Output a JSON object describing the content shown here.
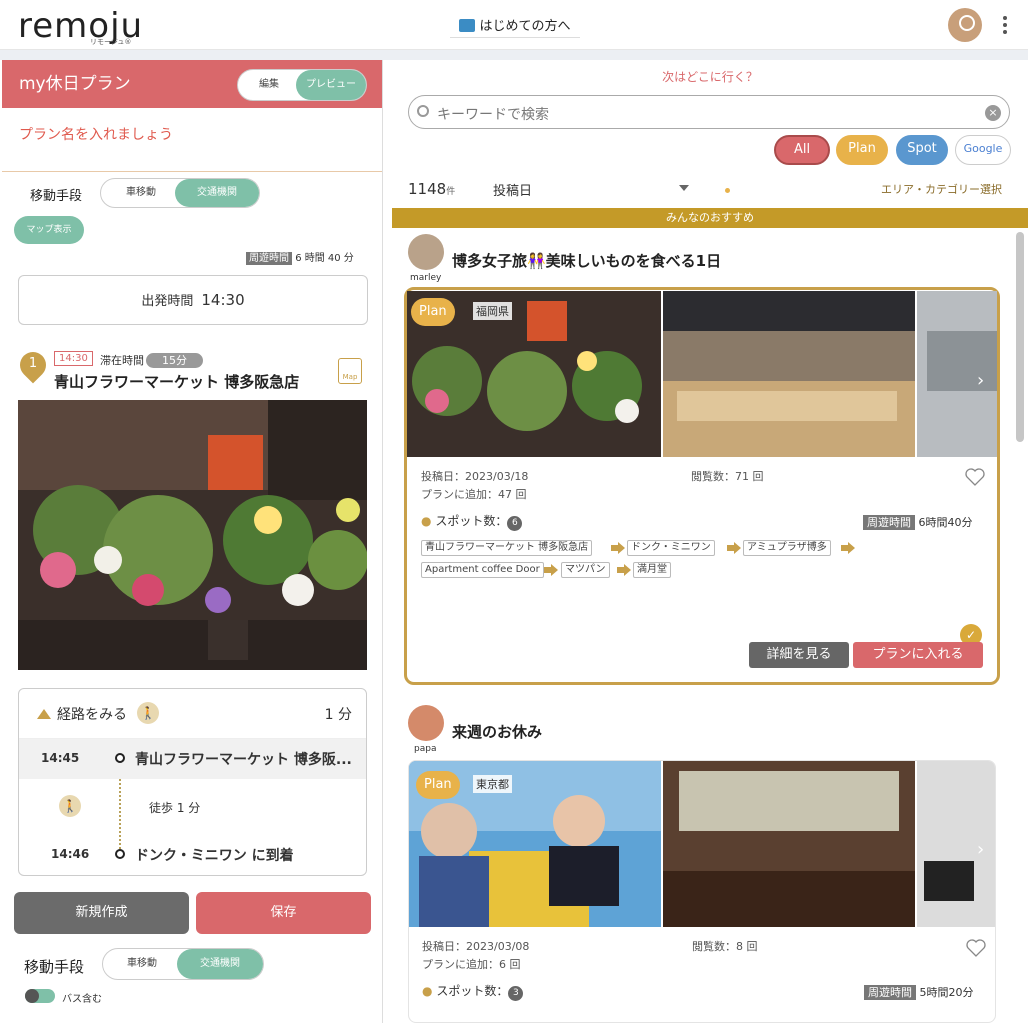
{
  "header": {
    "logo": "remoju",
    "logo_sub": "リモージュ®",
    "guide_label": "はじめての方へ"
  },
  "plan": {
    "title": "my休日プラン",
    "edit_label": "編集",
    "preview_label": "プレビュー",
    "name_placeholder": "プラン名を入れましょう",
    "move_label": "移動手段",
    "car_label": "車移動",
    "transit_label": "交通機関",
    "map_button": "マップ表示",
    "loop_tag": "周遊時間",
    "loop_time": "6 時間 40 分",
    "depart_label": "出発時間",
    "depart_time": "14:30"
  },
  "spot": {
    "number": "1",
    "time": "14:30",
    "stay_label": "滞在時間",
    "stay_value": "15分",
    "name": "青山フラワーマーケット 博多阪急店",
    "map_label": "Map"
  },
  "route": {
    "label": "経路をみる",
    "minutes": "1 分",
    "rows": [
      {
        "time": "14:45",
        "name": "青山フラワーマーケット 博多阪..."
      },
      {
        "time": "14:46",
        "name": "ドンク・ミニワン に到着"
      }
    ],
    "walk_text": "徒歩 1 分"
  },
  "buttons": {
    "new": "新規作成",
    "save": "保存"
  },
  "bottom_move": {
    "label": "移動手段",
    "car": "車移動",
    "transit": "交通機関",
    "bus": "バス含む"
  },
  "search": {
    "heading": "次はどこに行く？",
    "placeholder": "キーワードで検索",
    "filters": [
      "All",
      "Plan",
      "Spot",
      "Google"
    ],
    "count": "1148",
    "count_unit": "件",
    "sort": "投稿日",
    "area": "エリア・カテゴリー選択",
    "reco": "みんなのおすすめ"
  },
  "cards": [
    {
      "user": "marley",
      "title": "博多女子旅👭美味しいものを食べる1日",
      "badge": "Plan",
      "pref": "福岡県",
      "posted": "投稿日：2023/03/18",
      "added": "プランに追加：47 回",
      "views": "閲覧数：71 回",
      "spots_label": "スポット数：",
      "spots": "6",
      "loop_tag": "周遊時間",
      "loop": "6時間40分",
      "chips": [
        "青山フラワーマーケット 博多阪急店",
        "ドンク・ミニワン",
        "アミュプラザ博多",
        "Apartment coffee Door",
        "マツパン",
        "満月堂"
      ],
      "detail": "詳細を見る",
      "add": "プランに入れる"
    },
    {
      "user": "papa",
      "title": "来週のお休み",
      "badge": "Plan",
      "pref": "東京都",
      "posted": "投稿日：2023/03/08",
      "added": "プランに追加：6 回",
      "views": "閲覧数：8 回",
      "spots_label": "スポット数：",
      "spots": "3",
      "loop_tag": "周遊時間",
      "loop": "5時間20分"
    }
  ]
}
